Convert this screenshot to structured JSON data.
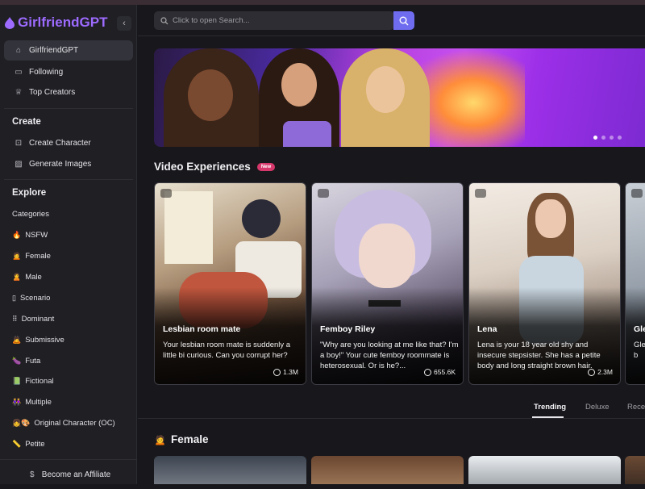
{
  "app": {
    "name": "GirlfriendGPT"
  },
  "sidebar": {
    "nav": [
      {
        "label": "GirlfriendGPT",
        "icon": "home-icon",
        "active": true
      },
      {
        "label": "Following",
        "icon": "folder-icon"
      },
      {
        "label": "Top Creators",
        "icon": "award-icon"
      }
    ],
    "create_title": "Create",
    "create_items": [
      {
        "label": "Create Character",
        "icon": "robot-icon"
      },
      {
        "label": "Generate Images",
        "icon": "image-icon"
      }
    ],
    "explore_title": "Explore",
    "categories_label": "Categories",
    "categories": [
      {
        "emoji": "🔥",
        "label": "NSFW"
      },
      {
        "emoji": "🙍",
        "label": "Female"
      },
      {
        "emoji": "🙎",
        "label": "Male"
      },
      {
        "emoji": "▯",
        "label": "Scenario"
      },
      {
        "emoji": "⠿",
        "label": "Dominant"
      },
      {
        "emoji": "🙇",
        "label": "Submissive"
      },
      {
        "emoji": "🍆",
        "label": "Futa"
      },
      {
        "emoji": "📗",
        "label": "Fictional"
      },
      {
        "emoji": "👭",
        "label": "Multiple"
      },
      {
        "emoji": "👧🎨",
        "label": "Original Character (OC)"
      },
      {
        "emoji": "📏",
        "label": "Petite"
      }
    ],
    "affiliate_label": "Become an Affiliate"
  },
  "search": {
    "placeholder": "Click to open Search..."
  },
  "video_section": {
    "title": "Video Experiences",
    "badge": "New"
  },
  "cards": [
    {
      "name": "Lesbian room mate",
      "desc": "Your lesbian room mate is suddenly a little bi curious. Can you corrupt her?",
      "views": "1.3M"
    },
    {
      "name": "Femboy Riley",
      "desc": "\"Why are you looking at me like that? I'm a boy!\" Your cute femboy roommate is heterosexual. Or is he?...",
      "views": "655.6K"
    },
    {
      "name": "Lena",
      "desc": "Lena is your 18 year old shy and insecure stepsister. She has a petite body and long straight brown hair.",
      "views": "2.3M"
    },
    {
      "name": "Gle",
      "desc": "Gle He b",
      "views": ""
    }
  ],
  "tabs": [
    "Trending",
    "Deluxe",
    "Rece"
  ],
  "female_section": {
    "emoji": "🙍",
    "title": "Female"
  },
  "colors": {
    "accent": "#6f6cf0",
    "brand": "#9d6bff",
    "badge": "#d6386b"
  }
}
